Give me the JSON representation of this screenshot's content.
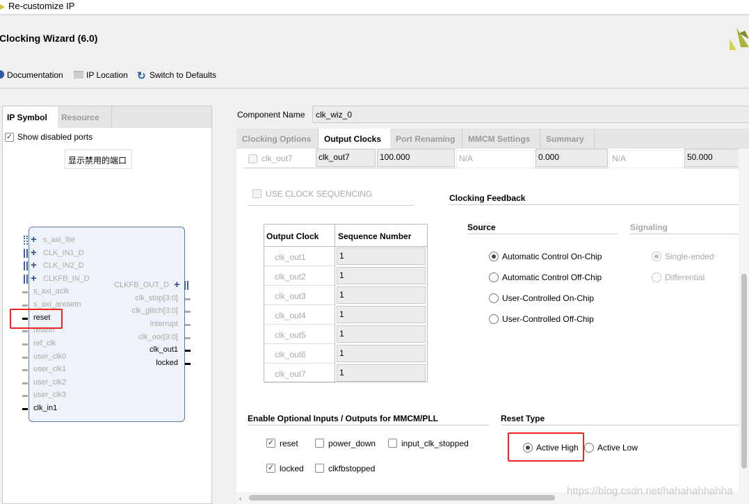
{
  "window": {
    "title": "Re-customize IP",
    "heading": "Clocking Wizard (6.0)"
  },
  "toolbar": {
    "documentation": "Documentation",
    "ip_location": "IP Location",
    "switch_defaults": "Switch to Defaults"
  },
  "left": {
    "tabs": [
      "IP Symbol",
      "Resource"
    ],
    "show_disabled": "Show disabled ports",
    "tooltip": "显示禁用的端口",
    "left_ports": [
      "s_axi_lite",
      "CLK_IN1_D",
      "CLK_IN2_D",
      "CLKFB_IN_D",
      "s_axi_aclk",
      "s_axi_aresetn",
      "reset",
      "resetn",
      "ref_clk",
      "user_clk0",
      "user_clk1",
      "user_clk2",
      "user_clk3",
      "clk_in1"
    ],
    "right_ports": [
      "CLKFB_OUT_D",
      "clk_stop[3:0]",
      "clk_glitch[3:0]",
      "interrupt",
      "clk_oor[3:0]",
      "clk_out1",
      "locked"
    ]
  },
  "component": {
    "label": "Component Name",
    "value": "clk_wiz_0"
  },
  "tabs": [
    "Clocking Options",
    "Output Clocks",
    "Port Renaming",
    "MMCM Settings",
    "Summary"
  ],
  "active_tab": "Output Clocks",
  "out7_row": {
    "name": "clk_out7",
    "port": "clk_out7",
    "freq": "100.000",
    "actual_freq": "N/A",
    "phase": "0.000",
    "actual_phase": "N/A",
    "duty": "50.000"
  },
  "sequencing": {
    "label": "USE CLOCK SEQUENCING",
    "headers": [
      "Output Clock",
      "Sequence Number"
    ],
    "rows": [
      [
        "clk_out1",
        "1"
      ],
      [
        "clk_out2",
        "1"
      ],
      [
        "clk_out3",
        "1"
      ],
      [
        "clk_out4",
        "1"
      ],
      [
        "clk_out5",
        "1"
      ],
      [
        "clk_out6",
        "1"
      ],
      [
        "clk_out7",
        "1"
      ]
    ]
  },
  "feedback": {
    "title": "Clocking Feedback",
    "source_title": "Source",
    "signaling_title": "Signaling",
    "sources": [
      "Automatic Control On-Chip",
      "Automatic Control Off-Chip",
      "User-Controlled On-Chip",
      "User-Controlled Off-Chip"
    ],
    "signaling": [
      "Single-ended",
      "Differential"
    ]
  },
  "optional": {
    "title": "Enable Optional Inputs / Outputs for MMCM/PLL",
    "items": [
      "reset",
      "power_down",
      "input_clk_stopped",
      "locked",
      "clkfbstopped"
    ]
  },
  "reset_type": {
    "title": "Reset Type",
    "options": [
      "Active High",
      "Active Low"
    ]
  },
  "watermark": "https://blog.csdn.net/hahahahhahha"
}
